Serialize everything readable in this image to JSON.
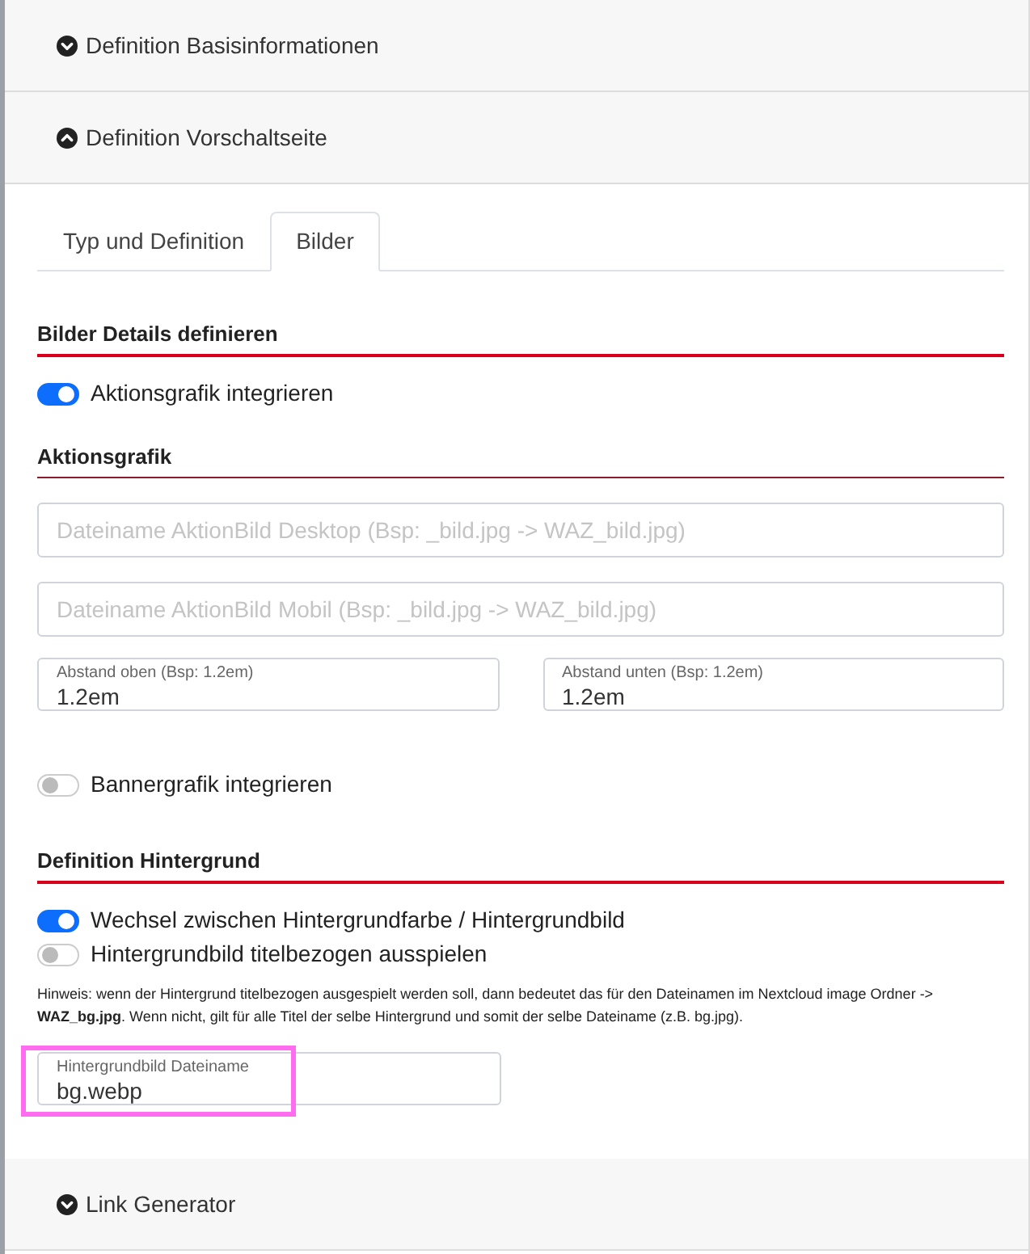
{
  "accordion": [
    {
      "title": "Definition Basisinformationen",
      "expanded": false
    },
    {
      "title": "Definition Vorschaltseite",
      "expanded": true,
      "content": {
        "tabs": [
          {
            "label": "Typ und Definition",
            "selected": false
          },
          {
            "label": "Bilder",
            "selected": true
          }
        ],
        "sections": [
          {
            "heading": "Bilder Details definieren",
            "kind": "section",
            "items": [
              {
                "kind": "toggle",
                "label": "Aktionsgrafik integrieren",
                "on": true
              }
            ]
          },
          {
            "heading": "Aktionsgrafik",
            "kind": "subsection",
            "items": [
              {
                "kind": "text_field",
                "placeholder": "Dateiname AktionBild Desktop (Bsp: _bild.jpg -> WAZ_bild.jpg)"
              },
              {
                "kind": "text_field",
                "placeholder": "Dateiname AktionBild Mobil (Bsp: _bild.jpg -> WAZ_bild.jpg)"
              },
              {
                "kind": "field_pair",
                "fields": [
                  {
                    "label": "Abstand oben (Bsp: 1.2em)",
                    "value": "1.2em"
                  },
                  {
                    "label": "Abstand unten (Bsp: 1.2em)",
                    "value": "1.2em"
                  }
                ]
              },
              {
                "kind": "toggle",
                "label": "Bannergrafik integrieren",
                "on": false
              }
            ]
          },
          {
            "heading": "Definition Hintergrund",
            "kind": "section",
            "items": [
              {
                "kind": "toggle",
                "label": "Wechsel zwischen Hintergrundfarbe / Hintergrundbild",
                "on": true
              },
              {
                "kind": "toggle",
                "label": "Hintergrundbild titelbezogen ausspielen",
                "on": false
              },
              {
                "kind": "note",
                "text": "Hinweis: wenn der Hintergrund titelbezogen ausgespielt werden soll, dann bedeutet das für den Dateinamen im Nextcloud image Ordner -> **WAZ_bg.jpg**. Wenn nicht, gilt für alle Titel der selbe Hintergrund und somit der selbe Dateiname (z.B. bg.jpg)."
              },
              {
                "kind": "labeled_field",
                "label": "Hintergrundbild Dateiname",
                "value": "bg.webp",
                "highlighted": true
              }
            ]
          }
        ]
      }
    },
    {
      "title": "Link Generator",
      "expanded": false
    }
  ]
}
